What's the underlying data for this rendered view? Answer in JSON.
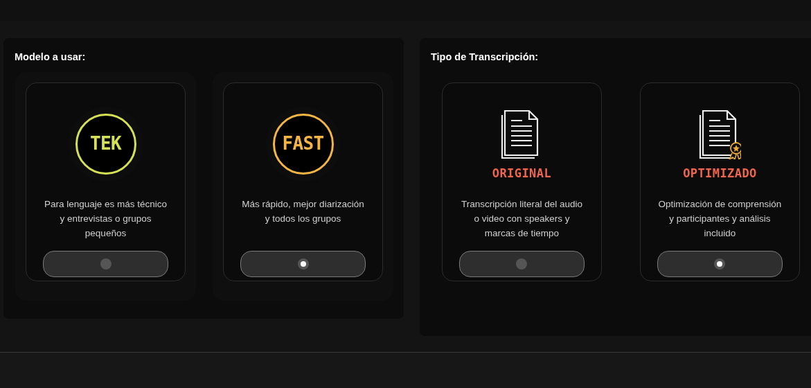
{
  "sections": [
    {
      "title": "Modelo a usar:",
      "options": [
        {
          "kind": "logo",
          "label": "TEK",
          "color": "#d4e157",
          "description": "Para lenguaje es más técnico y entrevistas o grupos pequeños",
          "selected": false
        },
        {
          "kind": "logo",
          "label": "FAST",
          "color": "#f5b545",
          "description": "Más rápido, mejor diarización y todos los grupos",
          "selected": true
        }
      ]
    },
    {
      "title": "Tipo de Transcripción:",
      "options": [
        {
          "kind": "document",
          "label": "ORIGINAL",
          "badge": false,
          "description": "Transcripción literal del audio o video con speakers y marcas de tiempo",
          "selected": false
        },
        {
          "kind": "document",
          "label": "OPTIMIZADO",
          "badge": true,
          "description": "Optimización de comprensión y participantes y análisis incluido",
          "selected": true
        }
      ]
    }
  ]
}
